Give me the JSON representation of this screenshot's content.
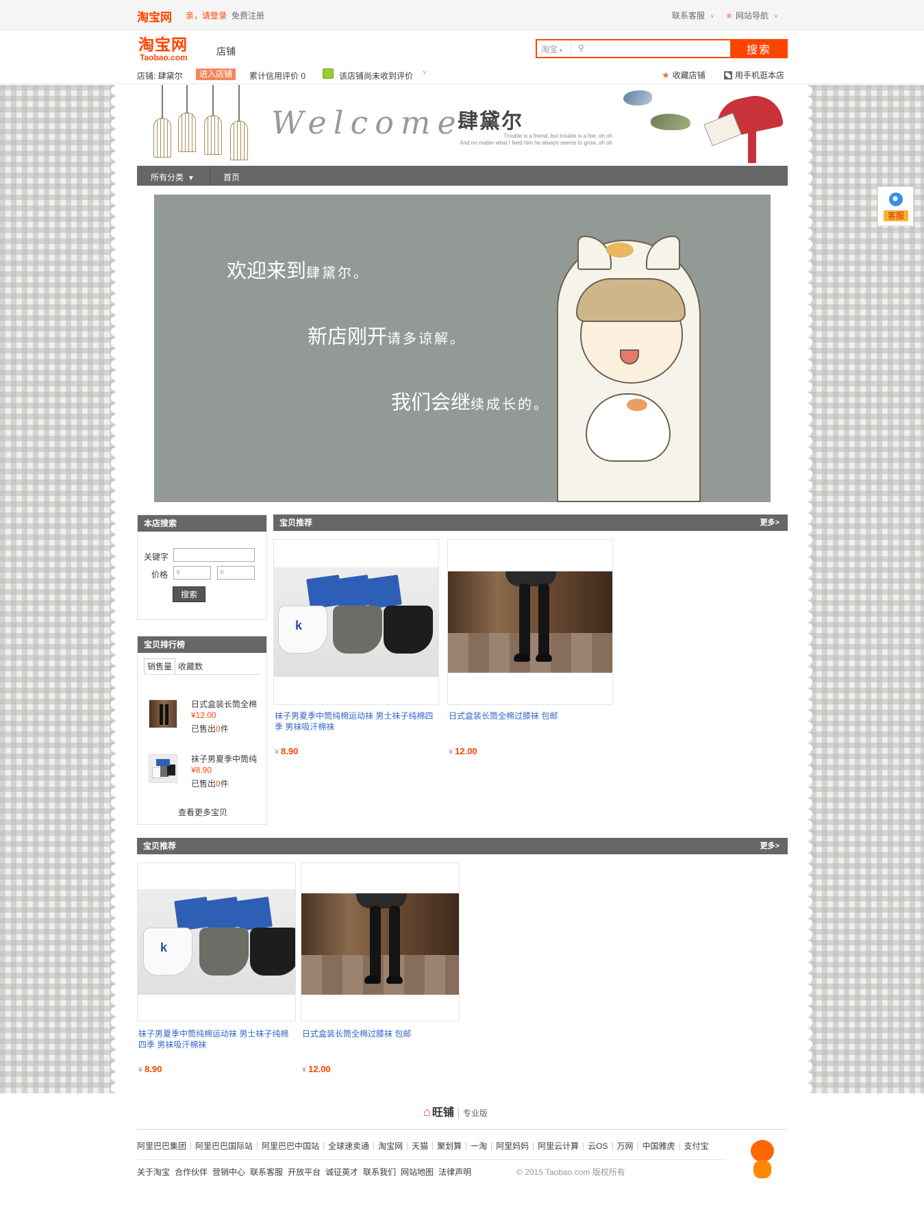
{
  "site_nav": {
    "logo_text": "淘宝网",
    "login": "亲，请登录",
    "register": "免费注册",
    "contact": "联系客服",
    "site_map": "网站导航"
  },
  "header": {
    "logo_cn": "淘宝网",
    "logo_en": "Taobao.com",
    "section": "店铺",
    "search": {
      "scope": "淘宝",
      "value": "",
      "button": "搜索"
    }
  },
  "shop_bar": {
    "shop_label": "店铺:  肆黛尔",
    "enter_shop": "进入店铺",
    "credit": "累计信用评价  0",
    "rating_note": "该店铺尚未收到评价",
    "favorite": "收藏店铺",
    "mobile": "用手机逛本店"
  },
  "banner": {
    "welcome": "Welcome",
    "shop_name": "肆黛尔",
    "tagline": "Trouble is a friend, but trouble is a foe, oh oh\nAnd no matter what I feed him he always seems to grow, oh oh"
  },
  "shop_nav": {
    "categories": "所有分类",
    "home": "首页"
  },
  "hero": {
    "line1_big": "欢迎来到",
    "line1_small": "肆黛尔。",
    "line2_big": "新店刚开",
    "line2_small": "请多谅解。",
    "line3_big": "我们会继",
    "line3_small": "续成长的。"
  },
  "shop_search": {
    "title": "本店搜索",
    "keyword_label": "关键字",
    "price_label": "价格",
    "price_min_placeholder": "¥",
    "price_max_placeholder": "¥",
    "button": "搜索"
  },
  "ranking": {
    "title": "宝贝排行榜",
    "tabs": [
      "销售量",
      "收藏数"
    ],
    "items": [
      {
        "name": "日式盒装长筒全棉",
        "price": "¥12.00",
        "sold_prefix": "已售出",
        "sold_count": "0",
        "sold_suffix": "件"
      },
      {
        "name": "袜子男夏季中筒纯",
        "price": "¥8.90",
        "sold_prefix": "已售出",
        "sold_count": "0",
        "sold_suffix": "件"
      }
    ],
    "more": "查看更多宝贝"
  },
  "recommend_1": {
    "title": "宝贝推荐",
    "more": "更多>",
    "items": [
      {
        "title": "袜子男夏季中筒纯棉运动袜 男士袜子纯棉四季 男袜吸汗棉袜",
        "currency": "¥",
        "price": "8.90"
      },
      {
        "title": "日式盒装长筒全棉过膝袜 包邮",
        "currency": "¥",
        "price": "12.00"
      }
    ]
  },
  "recommend_2": {
    "title": "宝贝推荐",
    "more": "更多>",
    "items": [
      {
        "title": "袜子男夏季中筒纯棉运动袜 男士袜子纯棉四季 男袜吸汗棉袜",
        "currency": "¥",
        "price": "8.90"
      },
      {
        "title": "日式盒装长筒全棉过膝袜 包邮",
        "currency": "¥",
        "price": "12.00"
      }
    ]
  },
  "customer_service": {
    "label": "客服"
  },
  "footer": {
    "wangpu": "旺铺",
    "edition": "专业版",
    "links_primary": [
      "阿里巴巴集团",
      "阿里巴巴国际站",
      "阿里巴巴中国站",
      "全球速卖通",
      "淘宝网",
      "天猫",
      "聚划算",
      "一淘",
      "阿里妈妈",
      "阿里云计算",
      "云OS",
      "万网",
      "中国雅虎",
      "支付宝"
    ],
    "links_secondary": [
      "关于淘宝",
      "合作伙伴",
      "营销中心",
      "联系客服",
      "开放平台",
      "诚征英才",
      "联系我们",
      "网站地图",
      "法律声明"
    ],
    "copyright": "© 2015 Taobao.com 版权所有"
  },
  "colors": {
    "accent": "#ff4400",
    "nav_bar": "#666666",
    "link": "#3366cc",
    "hero_bg": "#939a96"
  }
}
